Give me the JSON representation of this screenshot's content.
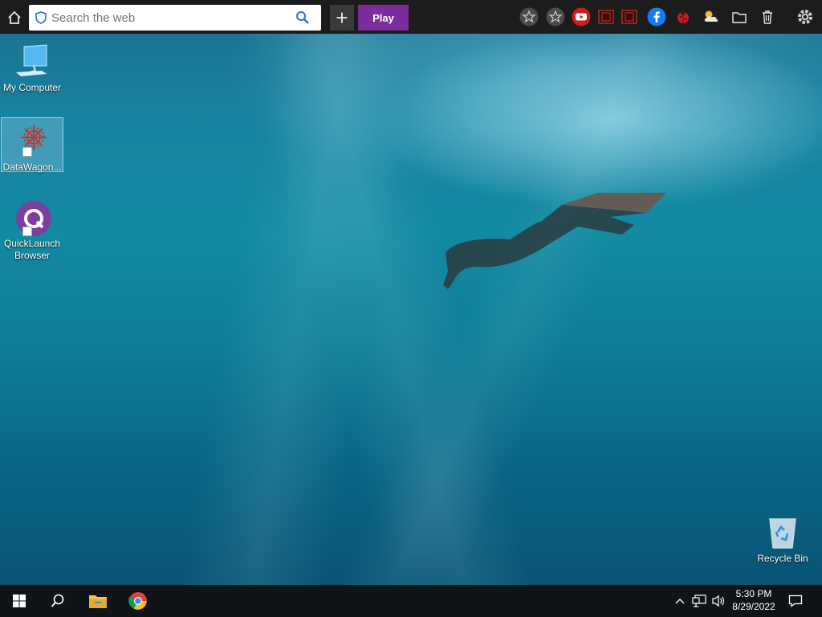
{
  "toolbar": {
    "search_placeholder": "Search the web",
    "play_label": "Play",
    "accent_play": "#7b2d9b",
    "icons": [
      "home-icon",
      "shield-icon",
      "search-icon",
      "plus-icon",
      "star-icon",
      "star-icon",
      "youtube-icon",
      "app-icon",
      "app-icon",
      "facebook-icon",
      "ladybug-icon",
      "weather-icon",
      "folder-icon",
      "trash-icon",
      "gear-icon"
    ]
  },
  "desktop": {
    "icons": [
      {
        "label": "My Computer"
      },
      {
        "label": "DataWagon..."
      },
      {
        "label_line1": "QuickLaunch",
        "label_line2": "Browser"
      },
      {
        "label": "Recycle Bin"
      }
    ]
  },
  "taskbar": {
    "time": "5:30 PM",
    "date": "8/29/2022"
  }
}
